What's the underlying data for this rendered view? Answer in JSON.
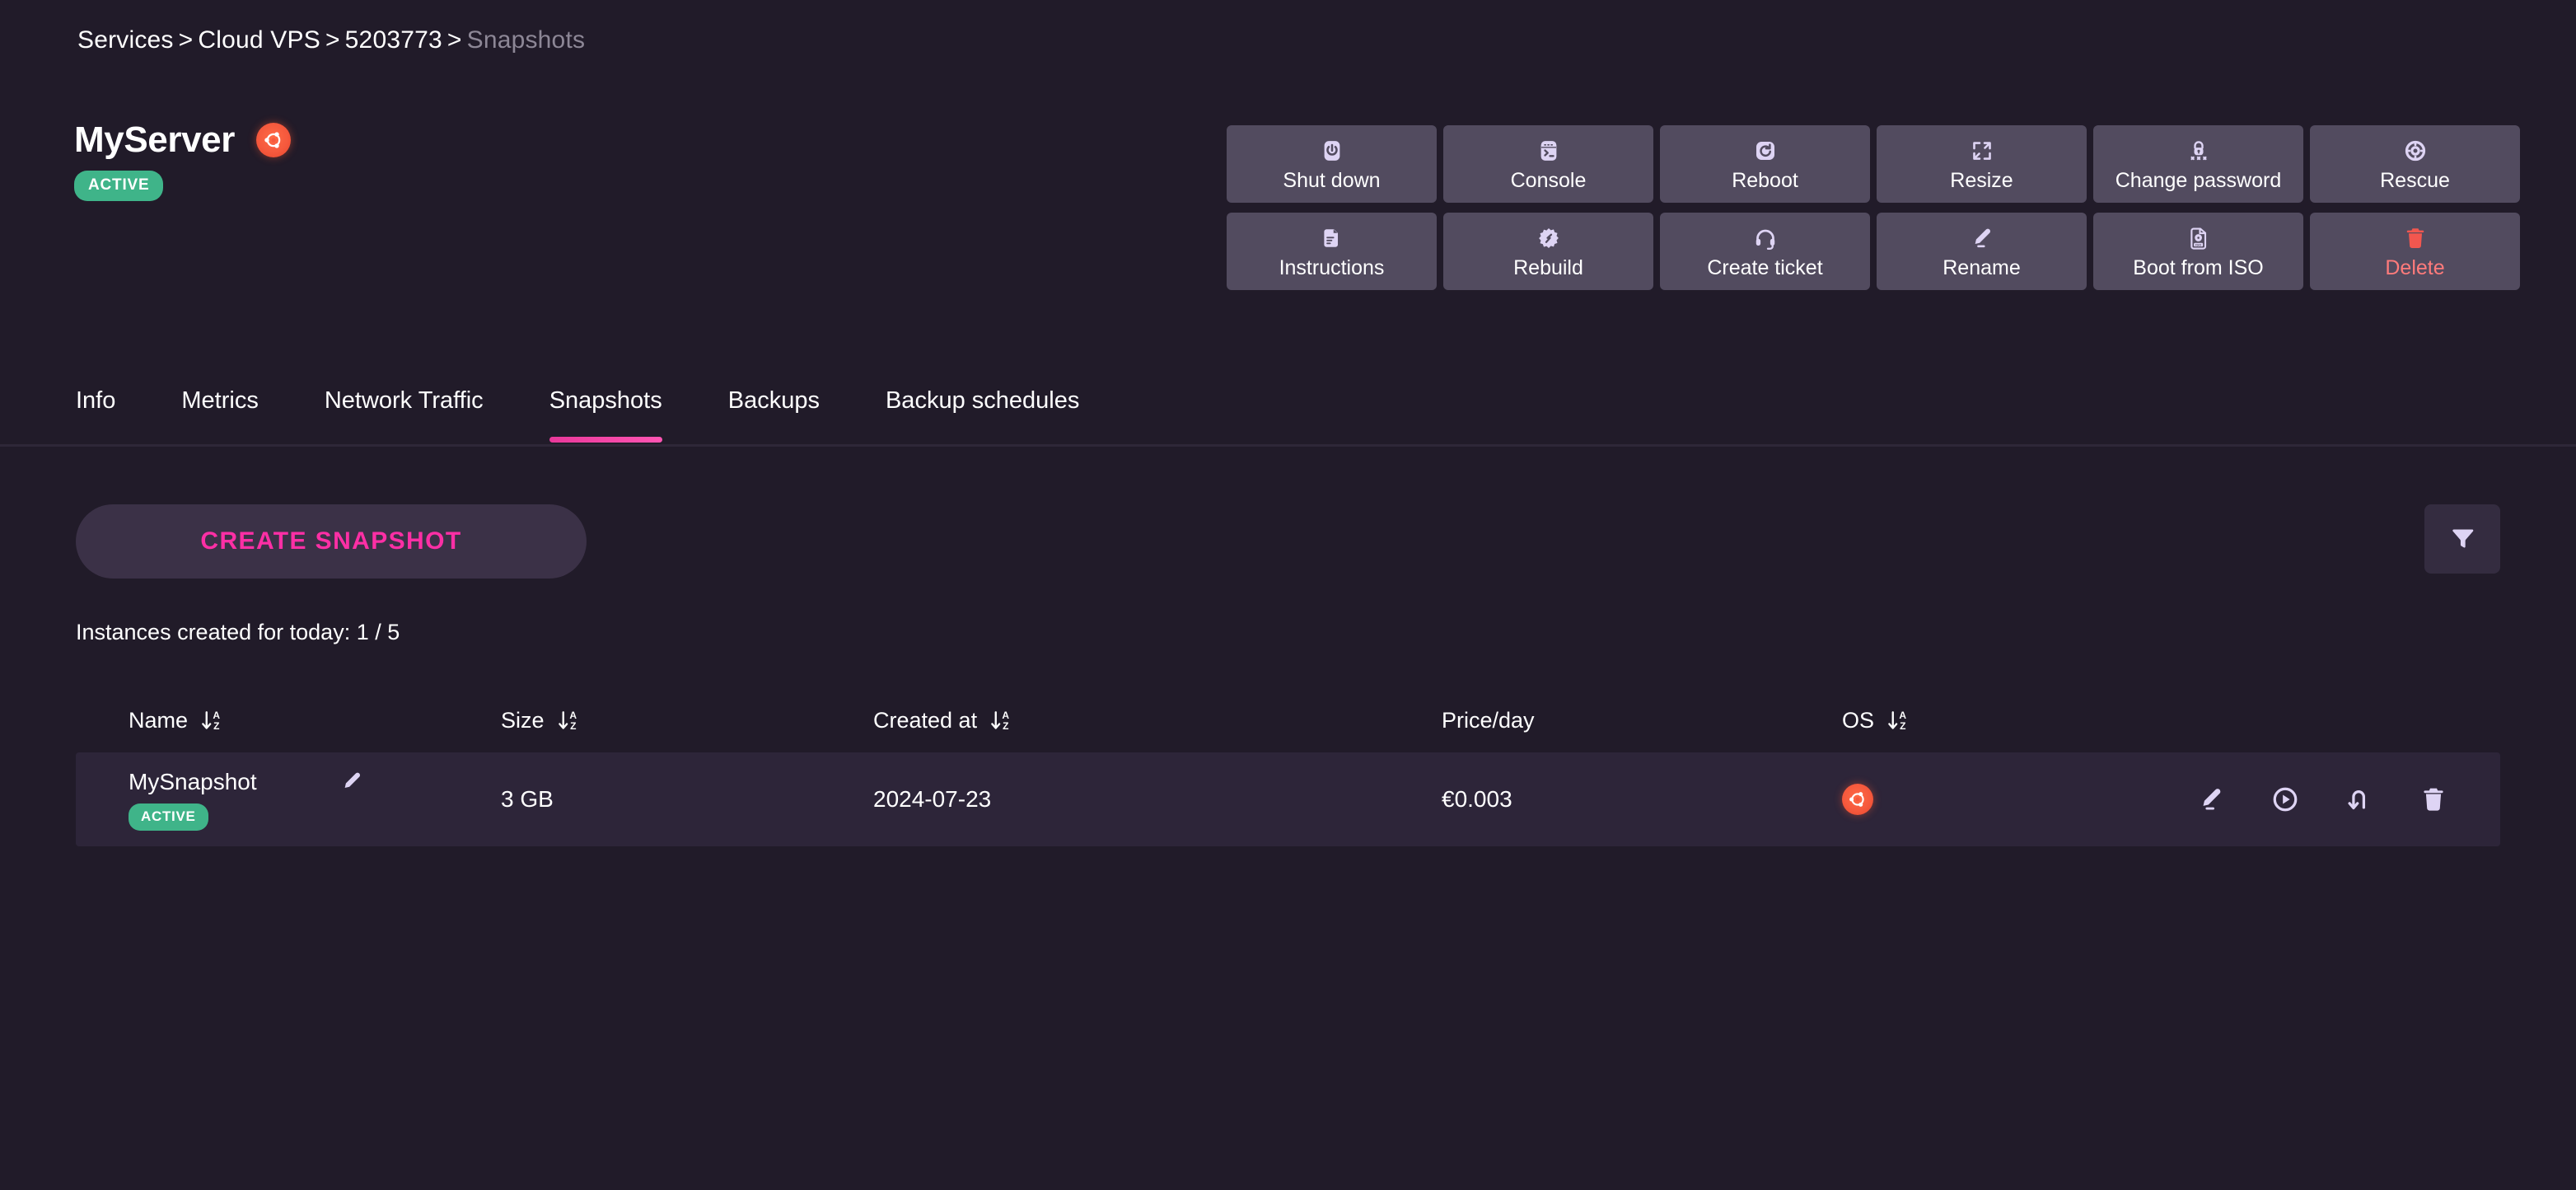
{
  "breadcrumb": {
    "items": [
      {
        "label": "Services",
        "current": false
      },
      {
        "label": "Cloud VPS",
        "current": false
      },
      {
        "label": "5203773",
        "current": false
      },
      {
        "label": "Snapshots",
        "current": true
      }
    ],
    "separator": ">"
  },
  "server": {
    "name": "MyServer",
    "os_icon": "ubuntu-icon",
    "status": "ACTIVE"
  },
  "actions": [
    {
      "label": "Shut down",
      "icon": "power-icon",
      "danger": false
    },
    {
      "label": "Console",
      "icon": "terminal-icon",
      "danger": false
    },
    {
      "label": "Reboot",
      "icon": "restart-icon",
      "danger": false
    },
    {
      "label": "Resize",
      "icon": "expand-icon",
      "danger": false
    },
    {
      "label": "Change password",
      "icon": "lock-password-icon",
      "danger": false
    },
    {
      "label": "Rescue",
      "icon": "lifebuoy-icon",
      "danger": false
    },
    {
      "label": "Instructions",
      "icon": "document-icon",
      "danger": false
    },
    {
      "label": "Rebuild",
      "icon": "rebuild-icon",
      "danger": false
    },
    {
      "label": "Create ticket",
      "icon": "headset-icon",
      "danger": false
    },
    {
      "label": "Rename",
      "icon": "pencil-icon",
      "danger": false
    },
    {
      "label": "Boot from ISO",
      "icon": "iso-disc-icon",
      "danger": false
    },
    {
      "label": "Delete",
      "icon": "trash-icon",
      "danger": true
    }
  ],
  "tabs": [
    {
      "label": "Info",
      "active": false
    },
    {
      "label": "Metrics",
      "active": false
    },
    {
      "label": "Network Traffic",
      "active": false
    },
    {
      "label": "Snapshots",
      "active": true
    },
    {
      "label": "Backups",
      "active": false
    },
    {
      "label": "Backup schedules",
      "active": false
    }
  ],
  "toolbar": {
    "create_label": "CREATE SNAPSHOT",
    "filter_icon": "filter-icon",
    "instances_note": "Instances created for today: 1 / 5"
  },
  "table": {
    "columns": [
      {
        "label": "Name",
        "sortable": true
      },
      {
        "label": "Size",
        "sortable": true
      },
      {
        "label": "Created at",
        "sortable": true
      },
      {
        "label": "Price/day",
        "sortable": false
      },
      {
        "label": "OS",
        "sortable": true
      }
    ],
    "rows": [
      {
        "name": "MySnapshot",
        "status": "ACTIVE",
        "size": "3 GB",
        "created_at": "2024-07-23",
        "price_day": "€0.003",
        "os_icon": "ubuntu-icon",
        "actions": [
          "pencil-icon",
          "play-circle-icon",
          "restore-icon",
          "trash-icon"
        ]
      }
    ]
  },
  "colors": {
    "page_bg": "#211b29",
    "panel_bg": "#524b5f",
    "row_bg": "#2d2539",
    "accent_pink": "#fc2fa5",
    "status_green": "#3fb489",
    "danger_red": "#ff7b7b",
    "icon_lavender": "#ded4f4",
    "ubuntu_orange": "#f5593d"
  }
}
